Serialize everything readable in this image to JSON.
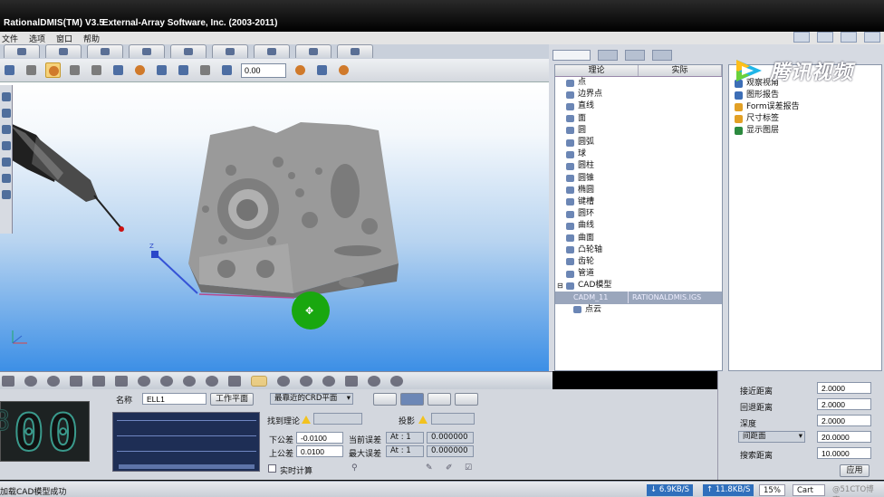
{
  "window": {
    "title": "RationalDMIS(TM) V3.5",
    "company": "External-Array Software, Inc. (2003-2011)"
  },
  "menu": [
    "文件",
    "选项",
    "窗口",
    "帮助"
  ],
  "toolbar": {
    "number_value": "0.00"
  },
  "tree": {
    "col_theory": "理论",
    "col_actual": "实际",
    "items": [
      "点",
      "边界点",
      "直线",
      "面",
      "圆",
      "圆弧",
      "球",
      "圆柱",
      "圆锥",
      "椭圆",
      "键槽",
      "圆环",
      "曲线",
      "曲面",
      "凸轮轴",
      "齿轮",
      "管道"
    ],
    "cad_group": "CAD模型",
    "cad_row": {
      "name": "CADM_11",
      "file": "RATIONALDMIS.IGS"
    },
    "point_cloud": "点云"
  },
  "reports": {
    "items": [
      "观察视角",
      "图形报告",
      "Form误差报告",
      "尺寸标签",
      "显示图层"
    ]
  },
  "watermark": {
    "text": "腾讯视频"
  },
  "feature_panel": {
    "counter": "00",
    "name_label": "名称",
    "name_value": "ELL1",
    "workplane_button": "工作平面",
    "crd_select": "最靠近的CRD平面",
    "find_theory_label": "找到理论",
    "projection_label": "投影",
    "lower_tol_label": "下公差",
    "lower_tol_value": "-0.0100",
    "upper_tol_label": "上公差",
    "upper_tol_value": "0.0100",
    "current_err_label": "当前误差",
    "current_err_at": "At : 1",
    "current_err_value": "0.000000",
    "max_err_label": "最大误差",
    "max_err_at": "At : 1",
    "max_err_value": "0.000000",
    "realtime_label": "实时计算"
  },
  "params": {
    "approach_label": "接近距离",
    "approach_value": "2.0000",
    "retract_label": "回退距离",
    "retract_value": "2.0000",
    "depth_label": "深度",
    "depth_value": "2.0000",
    "mode_select": "间距面",
    "mode_value": "20.0000",
    "search_label": "搜索距离",
    "search_value": "10.0000",
    "apply_button": "应用"
  },
  "status": {
    "message": "加载CAD模型成功",
    "down_speed": "6.9KB/S",
    "up_speed": "11.8KB/S",
    "percent": "15%",
    "mode": "Cart",
    "credit": "@51CTO博客"
  }
}
